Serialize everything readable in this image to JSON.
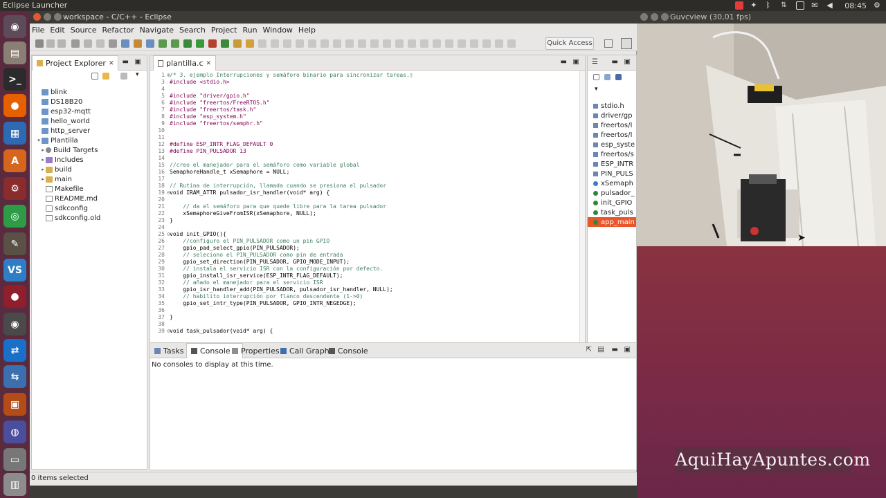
{
  "top_panel": {
    "app_name": "Eclipse Launcher",
    "clock": "08:45"
  },
  "launcher": {
    "items": [
      {
        "name": "ubuntu-dash-icon",
        "color": "#5e4b5a",
        "glyph": "◉"
      },
      {
        "name": "files-icon",
        "color": "#8a7f74",
        "glyph": "▤"
      },
      {
        "name": "terminal-icon",
        "color": "#2b2b2b",
        "glyph": ">_"
      },
      {
        "name": "firefox-icon",
        "color": "#e66000",
        "glyph": "●"
      },
      {
        "name": "writer-icon",
        "color": "#2e6ab3",
        "glyph": "▦"
      },
      {
        "name": "software-center-icon",
        "color": "#d6661d",
        "glyph": "A"
      },
      {
        "name": "settings-icon",
        "color": "#8b2c2c",
        "glyph": "⚙"
      },
      {
        "name": "chrome-icon",
        "color": "#2e9b47",
        "glyph": "◎"
      },
      {
        "name": "gimp-icon",
        "color": "#5a5045",
        "glyph": "✎"
      },
      {
        "name": "vscode-icon",
        "color": "#2e7dc6",
        "glyph": "VS"
      },
      {
        "name": "app-icon-red",
        "color": "#8f1f2a",
        "glyph": "●"
      },
      {
        "name": "webcam-icon",
        "color": "#4a4a4a",
        "glyph": "◉"
      },
      {
        "name": "teamviewer-icon",
        "color": "#1a6fc9",
        "glyph": "⇄"
      },
      {
        "name": "network-icon",
        "color": "#3a6fb0",
        "glyph": "⇆"
      },
      {
        "name": "eclipse-icon",
        "color": "#b44c18",
        "glyph": "▣"
      },
      {
        "name": "sphere-icon",
        "color": "#4b4e9c",
        "glyph": "◍"
      },
      {
        "name": "disk-icon",
        "color": "#777777",
        "glyph": "▭"
      },
      {
        "name": "trash-icon",
        "color": "#8c8c8c",
        "glyph": "▥"
      }
    ]
  },
  "eclipse": {
    "title": "workspace - C/C++ - Eclipse",
    "menu": [
      "File",
      "Edit",
      "Source",
      "Refactor",
      "Navigate",
      "Search",
      "Project",
      "Run",
      "Window",
      "Help"
    ],
    "quick_access": "Quick Access",
    "project_explorer": {
      "tab_label": "Project Explorer",
      "tree": [
        {
          "label": "blink",
          "depth": 0,
          "icon": "proj",
          "twisty": ""
        },
        {
          "label": "DS18B20",
          "depth": 0,
          "icon": "proj",
          "twisty": ""
        },
        {
          "label": "esp32-mqtt",
          "depth": 0,
          "icon": "proj",
          "twisty": ""
        },
        {
          "label": "hello_world",
          "depth": 0,
          "icon": "proj",
          "twisty": ""
        },
        {
          "label": "http_server",
          "depth": 0,
          "icon": "proj",
          "twisty": ""
        },
        {
          "label": "Plantilla",
          "depth": 0,
          "icon": "proj",
          "twisty": "▾"
        },
        {
          "label": "Build Targets",
          "depth": 1,
          "icon": "gear",
          "twisty": "▸"
        },
        {
          "label": "Includes",
          "depth": 1,
          "icon": "incl",
          "twisty": "▸"
        },
        {
          "label": "build",
          "depth": 1,
          "icon": "folder",
          "twisty": "▸"
        },
        {
          "label": "main",
          "depth": 1,
          "icon": "folder",
          "twisty": "▸"
        },
        {
          "label": "Makefile",
          "depth": 1,
          "icon": "file",
          "twisty": ""
        },
        {
          "label": "README.md",
          "depth": 1,
          "icon": "file",
          "twisty": ""
        },
        {
          "label": "sdkconfig",
          "depth": 1,
          "icon": "file",
          "twisty": ""
        },
        {
          "label": "sdkconfig.old",
          "depth": 1,
          "icon": "file",
          "twisty": ""
        }
      ]
    },
    "editor": {
      "tab_label": "plantilla.c",
      "lines": [
        {
          "n": "1",
          "fold": "⊕",
          "text": "/* 3. ejemplo Interrupciones y semáforo binario para sincronizar tareas.▯",
          "kind": "cm"
        },
        {
          "n": "3",
          "fold": "",
          "text": "#include <stdio.h>",
          "kind": "kw"
        },
        {
          "n": "4",
          "fold": "",
          "text": "",
          "kind": ""
        },
        {
          "n": "5",
          "fold": "",
          "text": "#include \"driver/gpio.h\"",
          "kind": "kw"
        },
        {
          "n": "6",
          "fold": "",
          "text": "#include \"freertos/FreeRTOS.h\"",
          "kind": "kw"
        },
        {
          "n": "7",
          "fold": "",
          "text": "#include \"freertos/task.h\"",
          "kind": "kw"
        },
        {
          "n": "8",
          "fold": "",
          "text": "#include \"esp_system.h\"",
          "kind": "kw"
        },
        {
          "n": "9",
          "fold": "",
          "text": "#include \"freertos/semphr.h\"",
          "kind": "kw"
        },
        {
          "n": "10",
          "fold": "",
          "text": "",
          "kind": ""
        },
        {
          "n": "11",
          "fold": "",
          "text": "",
          "kind": ""
        },
        {
          "n": "12",
          "fold": "",
          "text": "#define ESP_INTR_FLAG_DEFAULT 0",
          "kind": "kw"
        },
        {
          "n": "13",
          "fold": "",
          "text": "#define PIN_PULSADOR 13",
          "kind": "kw"
        },
        {
          "n": "14",
          "fold": "",
          "text": "",
          "kind": ""
        },
        {
          "n": "15",
          "fold": "",
          "text": "//creo el manejador para el semáforo como variable global",
          "kind": "cm"
        },
        {
          "n": "16",
          "fold": "",
          "text": "SemaphoreHandle_t xSemaphore = NULL;",
          "kind": ""
        },
        {
          "n": "17",
          "fold": "",
          "text": "",
          "kind": ""
        },
        {
          "n": "18",
          "fold": "",
          "text": "// Rutina de interrupción, llamada cuando se presiona el pulsador",
          "kind": "cm"
        },
        {
          "n": "19",
          "fold": "⊖",
          "text": "void IRAM_ATTR pulsador_isr_handler(void* arg) {",
          "kind": ""
        },
        {
          "n": "20",
          "fold": "",
          "text": "",
          "kind": ""
        },
        {
          "n": "21",
          "fold": "",
          "text": "    // da el semáforo para que quede libre para la tarea pulsador",
          "kind": "cm"
        },
        {
          "n": "22",
          "fold": "",
          "text": "    xSemaphoreGiveFromISR(xSemaphore, NULL);",
          "kind": ""
        },
        {
          "n": "23",
          "fold": "",
          "text": "}",
          "kind": ""
        },
        {
          "n": "24",
          "fold": "",
          "text": "",
          "kind": ""
        },
        {
          "n": "25",
          "fold": "⊖",
          "text": "void init_GPIO(){",
          "kind": ""
        },
        {
          "n": "26",
          "fold": "",
          "text": "    //configuro el PIN_PULSADOR como un pin GPIO",
          "kind": "cm"
        },
        {
          "n": "27",
          "fold": "",
          "text": "    gpio_pad_select_gpio(PIN_PULSADOR);",
          "kind": ""
        },
        {
          "n": "28",
          "fold": "",
          "text": "    // seleciono el PIN_PULSADOR como pin de entrada",
          "kind": "cm"
        },
        {
          "n": "29",
          "fold": "",
          "text": "    gpio_set_direction(PIN_PULSADOR, GPIO_MODE_INPUT);",
          "kind": ""
        },
        {
          "n": "30",
          "fold": "",
          "text": "    // instala el servicio ISR con la configuración por defecto.",
          "kind": "cm"
        },
        {
          "n": "31",
          "fold": "",
          "text": "    gpio_install_isr_service(ESP_INTR_FLAG_DEFAULT);",
          "kind": ""
        },
        {
          "n": "32",
          "fold": "",
          "text": "    // añado el manejador para el servicio ISR",
          "kind": "cm"
        },
        {
          "n": "33",
          "fold": "",
          "text": "    gpio_isr_handler_add(PIN_PULSADOR, pulsador_isr_handler, NULL);",
          "kind": ""
        },
        {
          "n": "34",
          "fold": "",
          "text": "    // habilito interrupción por flanco descendente (1->0)",
          "kind": "cm"
        },
        {
          "n": "35",
          "fold": "",
          "text": "    gpio_set_intr_type(PIN_PULSADOR, GPIO_INTR_NEGEDGE);",
          "kind": ""
        },
        {
          "n": "36",
          "fold": "",
          "text": "",
          "kind": ""
        },
        {
          "n": "37",
          "fold": "",
          "text": "}",
          "kind": ""
        },
        {
          "n": "38",
          "fold": "",
          "text": "",
          "kind": ""
        },
        {
          "n": "39",
          "fold": "⊖",
          "text": "void task_pulsador(void* arg) {",
          "kind": ""
        }
      ]
    },
    "outline": {
      "items": [
        {
          "label": "stdio.h",
          "icon": "hash",
          "selected": false
        },
        {
          "label": "driver/gp",
          "icon": "hash",
          "selected": false
        },
        {
          "label": "freertos/I",
          "icon": "hash",
          "selected": false
        },
        {
          "label": "freertos/I",
          "icon": "hash",
          "selected": false
        },
        {
          "label": "esp_syste",
          "icon": "hash",
          "selected": false
        },
        {
          "label": "freertos/s",
          "icon": "hash",
          "selected": false
        },
        {
          "label": "ESP_INTR",
          "icon": "hash",
          "selected": false
        },
        {
          "label": "PIN_PULS",
          "icon": "hash",
          "selected": false
        },
        {
          "label": "xSemaph",
          "icon": "var",
          "selected": false
        },
        {
          "label": "pulsador_",
          "icon": "fn",
          "selected": false
        },
        {
          "label": "init_GPIO",
          "icon": "fn",
          "selected": false
        },
        {
          "label": "task_puls",
          "icon": "fn",
          "selected": false
        },
        {
          "label": "app_main",
          "icon": "fn",
          "selected": true
        }
      ]
    },
    "console": {
      "tabs": [
        "Tasks",
        "Console",
        "Properties",
        "Call Graph",
        "Console"
      ],
      "active_tab": 1,
      "message": "No consoles to display at this time."
    },
    "status": "0 items selected"
  },
  "guvcview": {
    "title": "Guvcview (30,01 fps)"
  },
  "watermark": "AquiHayApuntes.com",
  "colors": {
    "selection": "#e8562a",
    "launcher_bg": "#5a2a3f",
    "desktop": "#7a2a46"
  }
}
